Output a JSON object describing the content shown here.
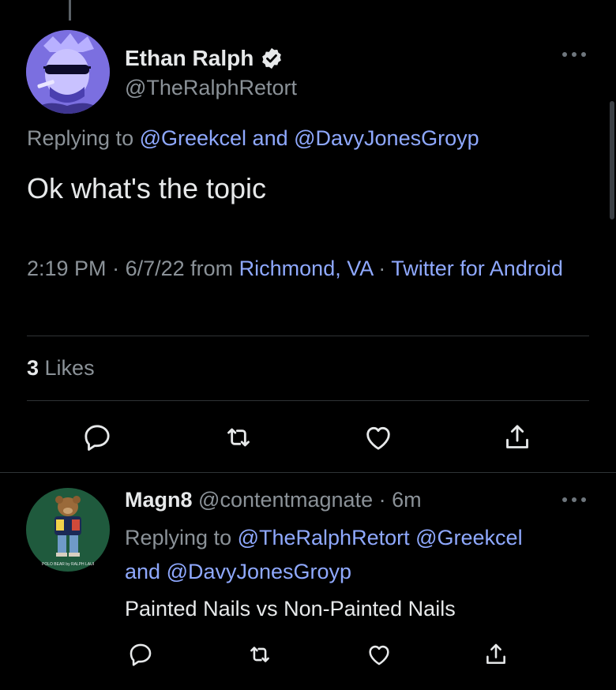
{
  "tweet": {
    "author_name": "Ethan Ralph",
    "author_handle": "@TheRalphRetort",
    "replying_prefix": "Replying to ",
    "replying_user_1": "@Greekcel",
    "replying_joiner": " and ",
    "replying_user_2": "@DavyJonesGroyp",
    "text": "Ok what's the topic",
    "time": "2:19 PM",
    "sep1": " · ",
    "date": "6/7/22",
    "from_word": " from ",
    "location": "Richmond, VA",
    "sep2": " · ",
    "client": "Twitter for Android",
    "likes_count": "3",
    "likes_label": " Likes"
  },
  "reply": {
    "author_name": "Magn8",
    "author_handle": "@contentmagnate",
    "sep": " · ",
    "age": "6m",
    "replying_prefix": "Replying to ",
    "replying_user_1": "@TheRalphRetort",
    "replying_user_2": "@Greekcel",
    "replying_joiner": "and ",
    "replying_user_3": "@DavyJonesGroyp",
    "text": "Painted Nails vs Non-Painted Nails",
    "avatar_caption": "POLO BEAR by RALPH LAUREN"
  },
  "colors": {
    "background": "#000000",
    "text_primary": "#e7e9ea",
    "text_secondary": "#8b9298",
    "link": "#8fa9ff",
    "divider": "#2f3336"
  },
  "icons": [
    "more-icon",
    "verified-badge-icon",
    "reply-icon",
    "retweet-icon",
    "like-icon",
    "share-icon"
  ]
}
